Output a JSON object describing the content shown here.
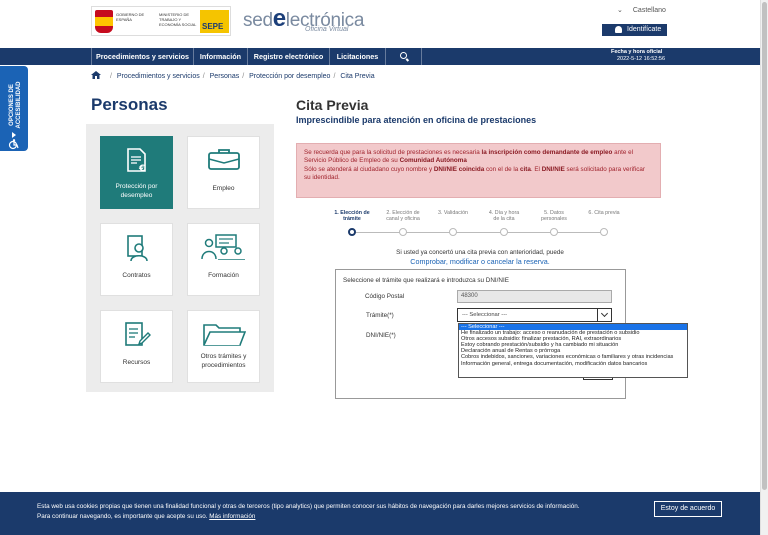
{
  "header": {
    "gob_text": "GOBIERNO DE ESPAÑA",
    "ministry_text": "MINISTERIO DE TRABAJO Y ECONOMÍA SOCIAL",
    "sepe_logo": "SEPE",
    "site_logo_pre": "sed",
    "site_logo_e": "e",
    "site_logo_post": "lectrónica",
    "site_subtitle": "Oficina Virtual",
    "language": "Castellano",
    "identify_label": "Identifícate"
  },
  "nav": {
    "items": [
      "Procedimientos y servicios",
      "Información",
      "Registro electrónico",
      "Licitaciones"
    ],
    "datetime_label": "Fecha y hora oficial",
    "datetime_value": "2022-5-12    16:52:56"
  },
  "accessibility": {
    "label": "OPCIONES DE ACCESIBILIDAD"
  },
  "breadcrumb": [
    "Procedimientos y servicios",
    "Personas",
    "Protección por desempleo",
    "Cita Previa"
  ],
  "left": {
    "title": "Personas",
    "tiles": [
      {
        "label": "Protección por desempleo"
      },
      {
        "label": "Empleo"
      },
      {
        "label": "Contratos"
      },
      {
        "label": "Formación"
      },
      {
        "label": "Recursos"
      },
      {
        "label": "Otros trámites y procedimientos"
      }
    ]
  },
  "main": {
    "title": "Cita Previa",
    "subtitle": "Imprescindible para atención en oficina de prestaciones",
    "alert": {
      "p1_a": "Se recuerda que para la solicitud de prestaciones es necesaria ",
      "p1_b": "la inscripción como demandante de empleo",
      "p1_c": " ante el Servicio Público de Empleo de su ",
      "p1_d": "Comunidad Autónoma",
      "p2_a": "Sólo se atenderá al ciudadano cuyo nombre y ",
      "p2_b": "DNI/NIE coincida",
      "p2_c": " con el de la ",
      "p2_d": "cita",
      "p2_e": ". El ",
      "p2_f": "DNI/NIE",
      "p2_g": " será solicitado para verificar su identidad."
    },
    "steps": [
      {
        "l1": "1. Elección de",
        "l2": "trámite"
      },
      {
        "l1": "2. Elección de",
        "l2": "canal y oficina"
      },
      {
        "l1": "3. Validación",
        "l2": ""
      },
      {
        "l1": "4. Día y hora",
        "l2": "de la cita"
      },
      {
        "l1": "5. Datos",
        "l2": "personales"
      },
      {
        "l1": "6. Cita previa",
        "l2": ""
      }
    ],
    "prev_note": "Si usted ya concertó una cita previa con anterioridad, puede",
    "prev_link": "Comprobar, modificar o cancelar la reserva.",
    "form": {
      "heading": "Seleccione el trámite que realizará e introduzca su DNI/NIE",
      "cp_label": "Código Postal",
      "cp_value": "48300",
      "tramite_label": "Trámite(*)",
      "tramite_selected": "--- Seleccionar ---",
      "dni_label": "DNI/NIE(*)",
      "options": [
        "--- Seleccionar ---",
        "He finalizado un trabajo: acceso o reanudación de prestación o subsidio",
        "Otros accesos subsidio: finalizar prestación, RAI, extraordinarios",
        "Estoy cobrando prestación/subsidio y ha cambiado mi situación",
        "Declaración anual de Rentas o prórroga",
        "Cobros indebidos, sanciones, variaciones económicas o familiares y otras incidencias",
        "Información general, entrega documentación, modificación datos bancarios"
      ]
    }
  },
  "cookie": {
    "line1": "Esta web usa cookies propias que tienen una finalidad funcional y otras de terceros (tipo analytics) que permiten conocer sus hábitos de navegación para darles mejores servicios de información.",
    "line2": "Para continuar navegando, es importante que acepte su uso. ",
    "more_link": "Más información",
    "accept": "Estoy de acuerdo"
  }
}
